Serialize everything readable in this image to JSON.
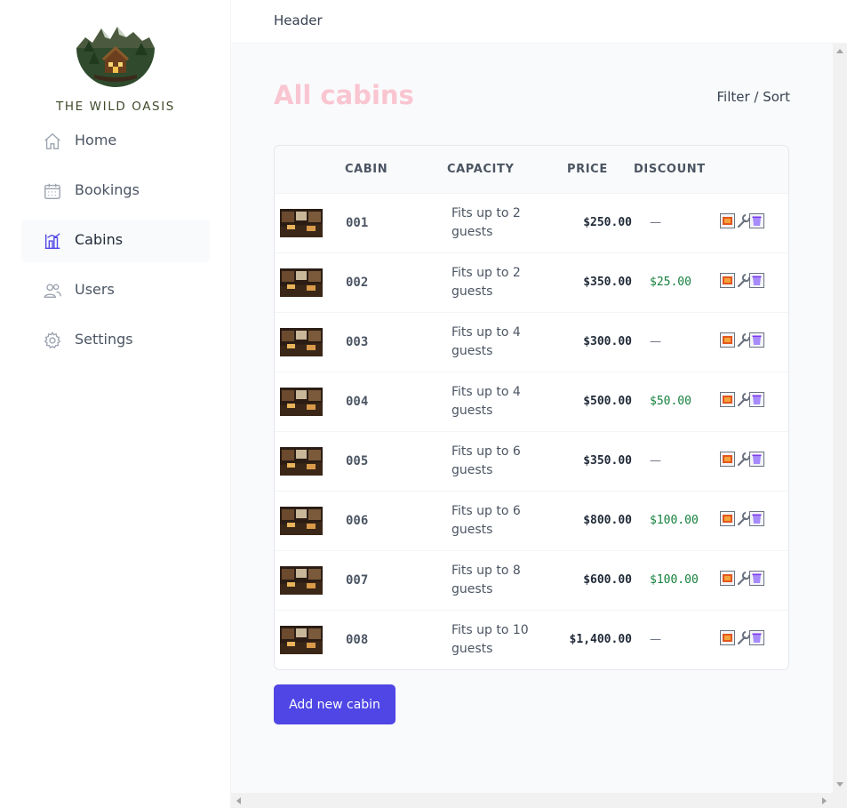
{
  "brand": {
    "name": "THE WILD OASIS"
  },
  "sidebar": {
    "items": [
      {
        "label": "Home",
        "icon": "home-icon",
        "active": false
      },
      {
        "label": "Bookings",
        "icon": "calendar-icon",
        "active": false
      },
      {
        "label": "Cabins",
        "icon": "chart-building-icon",
        "active": true
      },
      {
        "label": "Users",
        "icon": "users-icon",
        "active": false
      },
      {
        "label": "Settings",
        "icon": "gear-icon",
        "active": false
      }
    ]
  },
  "header": {
    "text": "Header"
  },
  "main": {
    "title": "All cabins",
    "filter_sort": "Filter / Sort",
    "columns": [
      "CABIN",
      "CAPACITY",
      "PRICE",
      "DISCOUNT"
    ],
    "rows": [
      {
        "name": "001",
        "capacity": "Fits up to 2 guests",
        "price": "$250.00",
        "discount": "—"
      },
      {
        "name": "002",
        "capacity": "Fits up to 2 guests",
        "price": "$350.00",
        "discount": "$25.00"
      },
      {
        "name": "003",
        "capacity": "Fits up to 4 guests",
        "price": "$300.00",
        "discount": "—"
      },
      {
        "name": "004",
        "capacity": "Fits up to 4 guests",
        "price": "$500.00",
        "discount": "$50.00"
      },
      {
        "name": "005",
        "capacity": "Fits up to 6 guests",
        "price": "$350.00",
        "discount": "—"
      },
      {
        "name": "006",
        "capacity": "Fits up to 6 guests",
        "price": "$800.00",
        "discount": "$100.00"
      },
      {
        "name": "007",
        "capacity": "Fits up to 8 guests",
        "price": "$600.00",
        "discount": "$100.00"
      },
      {
        "name": "008",
        "capacity": "Fits up to 10 guests",
        "price": "$1,400.00",
        "discount": "—"
      }
    ],
    "add_button": "Add new cabin"
  },
  "colors": {
    "accent": "#4f46e5",
    "title": "#f9c5d1",
    "discount": "#15803d",
    "background": "#f9fafb"
  }
}
